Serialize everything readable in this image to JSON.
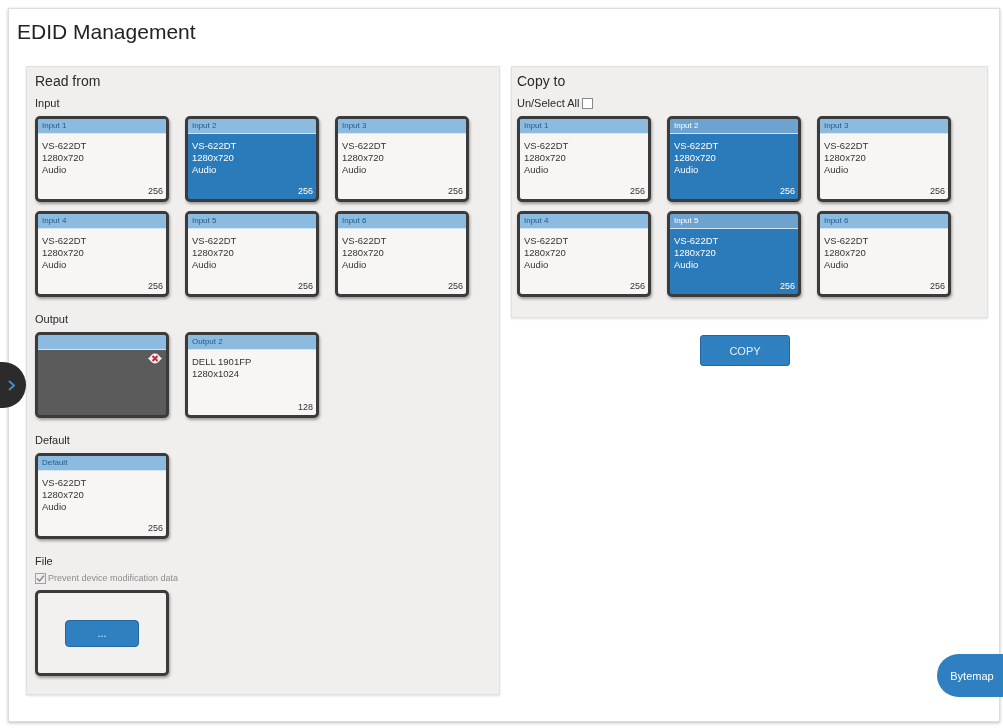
{
  "page": {
    "title": "EDID Management"
  },
  "read_from": {
    "title": "Read from",
    "input": {
      "label": "Input",
      "cards": [
        {
          "title": "Input 1",
          "lines": [
            "VS-622DT",
            "1280x720",
            "Audio"
          ],
          "size": "256",
          "selected": false
        },
        {
          "title": "Input 2",
          "lines": [
            "VS-622DT",
            "1280x720",
            "Audio"
          ],
          "size": "256",
          "selected": true
        },
        {
          "title": "Input 3",
          "lines": [
            "VS-622DT",
            "1280x720",
            "Audio"
          ],
          "size": "256",
          "selected": false
        },
        {
          "title": "Input 4",
          "lines": [
            "VS-622DT",
            "1280x720",
            "Audio"
          ],
          "size": "256",
          "selected": false
        },
        {
          "title": "Input 5",
          "lines": [
            "VS-622DT",
            "1280x720",
            "Audio"
          ],
          "size": "256",
          "selected": false
        },
        {
          "title": "Input 6",
          "lines": [
            "VS-622DT",
            "1280x720",
            "Audio"
          ],
          "size": "256",
          "selected": false
        }
      ]
    },
    "output": {
      "label": "Output",
      "cards": [
        {
          "kind": "disconnected",
          "selected": false
        },
        {
          "kind": "edid",
          "title": "Output 2",
          "lines": [
            "DELL 1901FP",
            "1280x1024"
          ],
          "size": "128",
          "selected": false
        }
      ]
    },
    "default": {
      "label": "Default",
      "cards": [
        {
          "title": "Default",
          "lines": [
            "VS-622DT",
            "1280x720",
            "Audio"
          ],
          "size": "256",
          "selected": false
        }
      ]
    },
    "file": {
      "label": "File",
      "checkbox": {
        "label": "Prevent device modification data",
        "checked": true,
        "disabled": true
      },
      "button": "..."
    }
  },
  "copy_to": {
    "title": "Copy to",
    "select_all": {
      "label": "Un/Select All",
      "checked": false
    },
    "cards": [
      {
        "title": "Input 1",
        "lines": [
          "VS-622DT",
          "1280x720",
          "Audio"
        ],
        "size": "256",
        "selected": false
      },
      {
        "title": "Input 2",
        "lines": [
          "VS-622DT",
          "1280x720",
          "Audio"
        ],
        "size": "256",
        "selected": true
      },
      {
        "title": "Input 3",
        "lines": [
          "VS-622DT",
          "1280x720",
          "Audio"
        ],
        "size": "256",
        "selected": false
      },
      {
        "title": "Input 4",
        "lines": [
          "VS-622DT",
          "1280x720",
          "Audio"
        ],
        "size": "256",
        "selected": false
      },
      {
        "title": "Input 5",
        "lines": [
          "VS-622DT",
          "1280x720",
          "Audio"
        ],
        "size": "256",
        "selected": true
      },
      {
        "title": "Input 6",
        "lines": [
          "VS-622DT",
          "1280x720",
          "Audio"
        ],
        "size": "256",
        "selected": false
      }
    ]
  },
  "copy_button": "COPY",
  "bytemap_button": "Bytemap"
}
